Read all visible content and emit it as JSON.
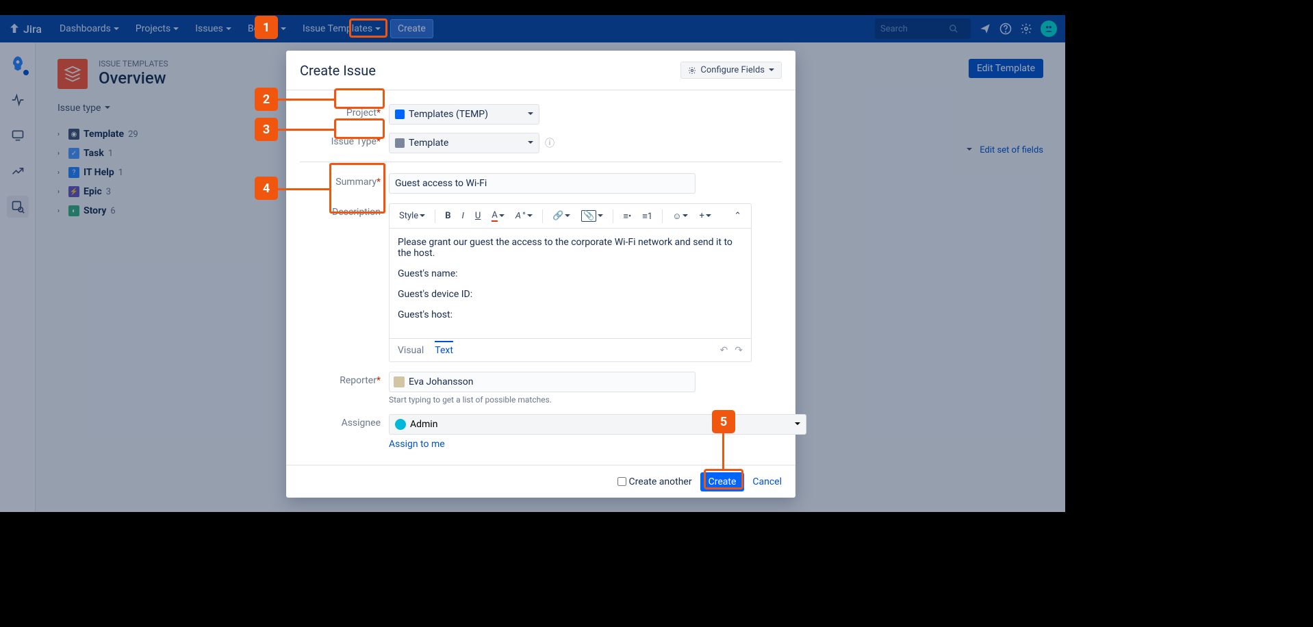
{
  "nav": {
    "logo": "Jira",
    "items": [
      "Dashboards",
      "Projects",
      "Issues",
      "Boards",
      "Issue Templates"
    ],
    "create": "Create",
    "search_placeholder": "Search"
  },
  "page": {
    "crumb": "ISSUE TEMPLATES",
    "title": "Overview",
    "edit_btn": "Edit Template",
    "filter": "Issue type",
    "edit_fields": "Edit set of fields"
  },
  "tree": [
    {
      "icon": "ic-template",
      "label": "Template",
      "count": "29"
    },
    {
      "icon": "ic-task",
      "label": "Task",
      "count": "1"
    },
    {
      "icon": "ic-ithelp",
      "label": "IT Help",
      "count": "1"
    },
    {
      "icon": "ic-epic",
      "label": "Epic",
      "count": "3"
    },
    {
      "icon": "ic-story",
      "label": "Story",
      "count": "6"
    }
  ],
  "dialog": {
    "title": "Create Issue",
    "configure": "Configure Fields",
    "labels": {
      "project": "Project",
      "issuetype": "Issue Type",
      "summary": "Summary",
      "description": "Description",
      "reporter": "Reporter",
      "assignee": "Assignee"
    },
    "project_value": "Templates (TEMP)",
    "issuetype_value": "Template",
    "summary_value": "Guest access to Wi-Fi",
    "desc": {
      "p1": "Please grant our guest the access to the corporate Wi-Fi network and send it to the host.",
      "p2": "Guest's name:",
      "p3": "Guest's device ID:",
      "p4": "Guest's host:"
    },
    "style_btn": "Style",
    "tabs": {
      "visual": "Visual",
      "text": "Text"
    },
    "reporter_value": "Eva Johansson",
    "reporter_hint": "Start typing to get a list of possible matches.",
    "assignee_value": "Admin",
    "assign_me": "Assign to me",
    "create_another": "Create another",
    "create_btn": "Create",
    "cancel": "Cancel"
  },
  "anno": {
    "n1": "1",
    "n2": "2",
    "n3": "3",
    "n4": "4",
    "n5": "5"
  }
}
